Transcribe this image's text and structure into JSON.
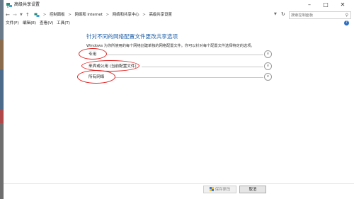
{
  "window": {
    "title": "高级共享设置"
  },
  "addressbar": {
    "crumbs": [
      "控制面板",
      "网络和 Internet",
      "网络和共享中心",
      "高级共享设置"
    ],
    "search_placeholder": "搜索控制面板"
  },
  "menubar": {
    "items": [
      "文件(F)",
      "编辑(E)",
      "查看(V)",
      "工具(T)"
    ]
  },
  "content": {
    "heading": "针对不同的网络配置文件更改共享选项",
    "description": "Windows 为你所使用的每个网络创建单独的网络配置文件。你可以针对每个配置文件选择特定的选项。",
    "sections": [
      {
        "label": "专用"
      },
      {
        "label": "来宾或公用 (当前配置文件)"
      },
      {
        "label": "所有网络"
      }
    ]
  },
  "footer": {
    "save_label": "保存更改",
    "cancel_label": "取消"
  },
  "colors": {
    "heading": "#1e5fa8",
    "annotation": "#e02020",
    "control_panel_icon": "#2a8a7a"
  }
}
